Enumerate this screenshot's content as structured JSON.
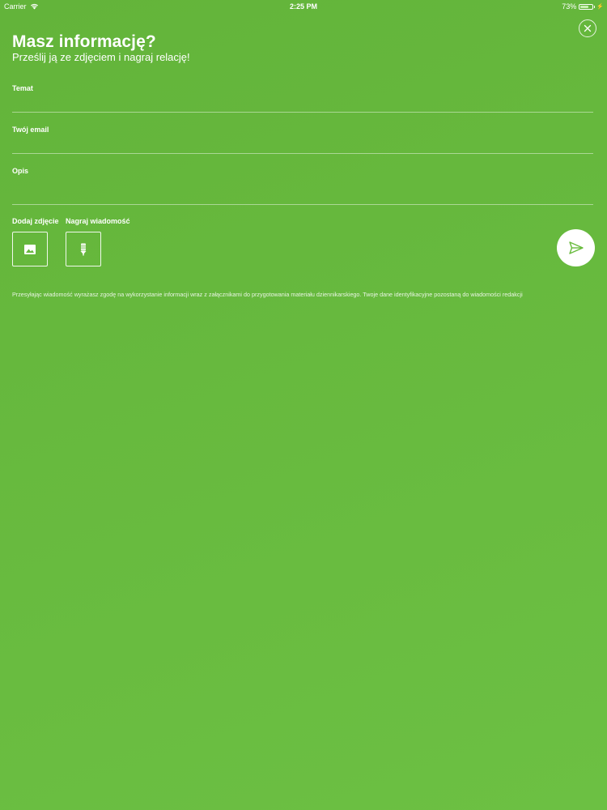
{
  "status_bar": {
    "carrier": "Carrier",
    "time": "2:25 PM",
    "battery_percent": "73%",
    "battery_level": 0.73
  },
  "icons": {
    "wifi": "wifi-icon",
    "battery": "battery-icon",
    "charging": "bolt-icon",
    "close": "close-icon",
    "photo": "image-icon",
    "microphone": "microphone-icon",
    "send": "send-icon"
  },
  "colors": {
    "background_start": "#63b43a",
    "background_end": "#6cc043",
    "foreground": "#ffffff",
    "send_icon": "#68bb3d"
  },
  "header": {
    "title": "Masz informację?",
    "subtitle": "Prześlij ją ze zdjęciem i nagraj relację!"
  },
  "form": {
    "subject": {
      "label": "Temat",
      "value": "",
      "placeholder": ""
    },
    "email": {
      "label": "Twój email",
      "value": "",
      "placeholder": ""
    },
    "description": {
      "label": "Opis",
      "value": "",
      "placeholder": ""
    }
  },
  "attachments": {
    "photo_label": "Dodaj zdjęcie",
    "audio_label": "Nagraj wiadomość"
  },
  "consent": "Przesyłając wiadomość wyrażasz zgodę na wykorzystanie informacji wraz z załącznikami do przygotowania materiału dziennikarskiego. Twoje dane identyfikacyjne pozostaną do wiadomości redakcji"
}
